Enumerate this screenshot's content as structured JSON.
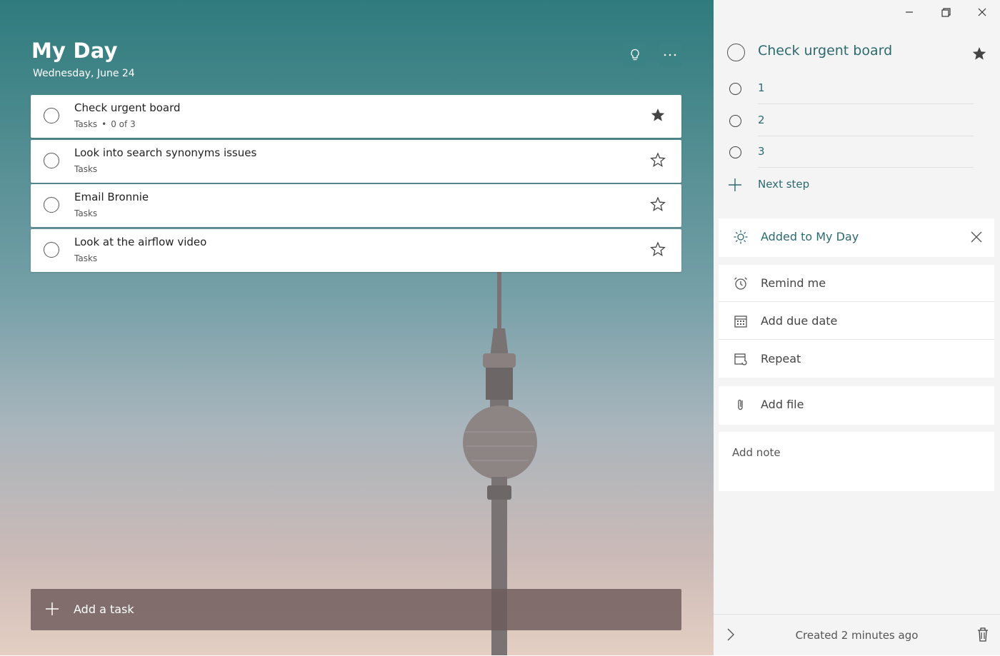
{
  "list": {
    "title": "My Day",
    "date": "Wednesday, June 24",
    "suggestions_icon": "lightbulb-icon",
    "more_icon": "more-icon"
  },
  "tasks": [
    {
      "title": "Check urgent board",
      "list": "Tasks",
      "steps": "0 of 3",
      "important": true
    },
    {
      "title": "Look into search synonyms issues",
      "list": "Tasks",
      "important": false
    },
    {
      "title": "Email Bronnie",
      "list": "Tasks",
      "important": false
    },
    {
      "title": "Look at the airflow video",
      "list": "Tasks",
      "important": false
    }
  ],
  "add_task": {
    "label": "Add a task"
  },
  "detail": {
    "title": "Check urgent board",
    "important": true,
    "steps": [
      "1",
      "2",
      "3"
    ],
    "next_step": "Next step",
    "my_day": "Added to My Day",
    "remind": "Remind me",
    "due": "Add due date",
    "repeat": "Repeat",
    "file": "Add file",
    "note_placeholder": "Add note",
    "created": "Created 2 minutes ago"
  },
  "colors": {
    "accent": "#2c6a6f",
    "header_button": "#3a8284"
  }
}
